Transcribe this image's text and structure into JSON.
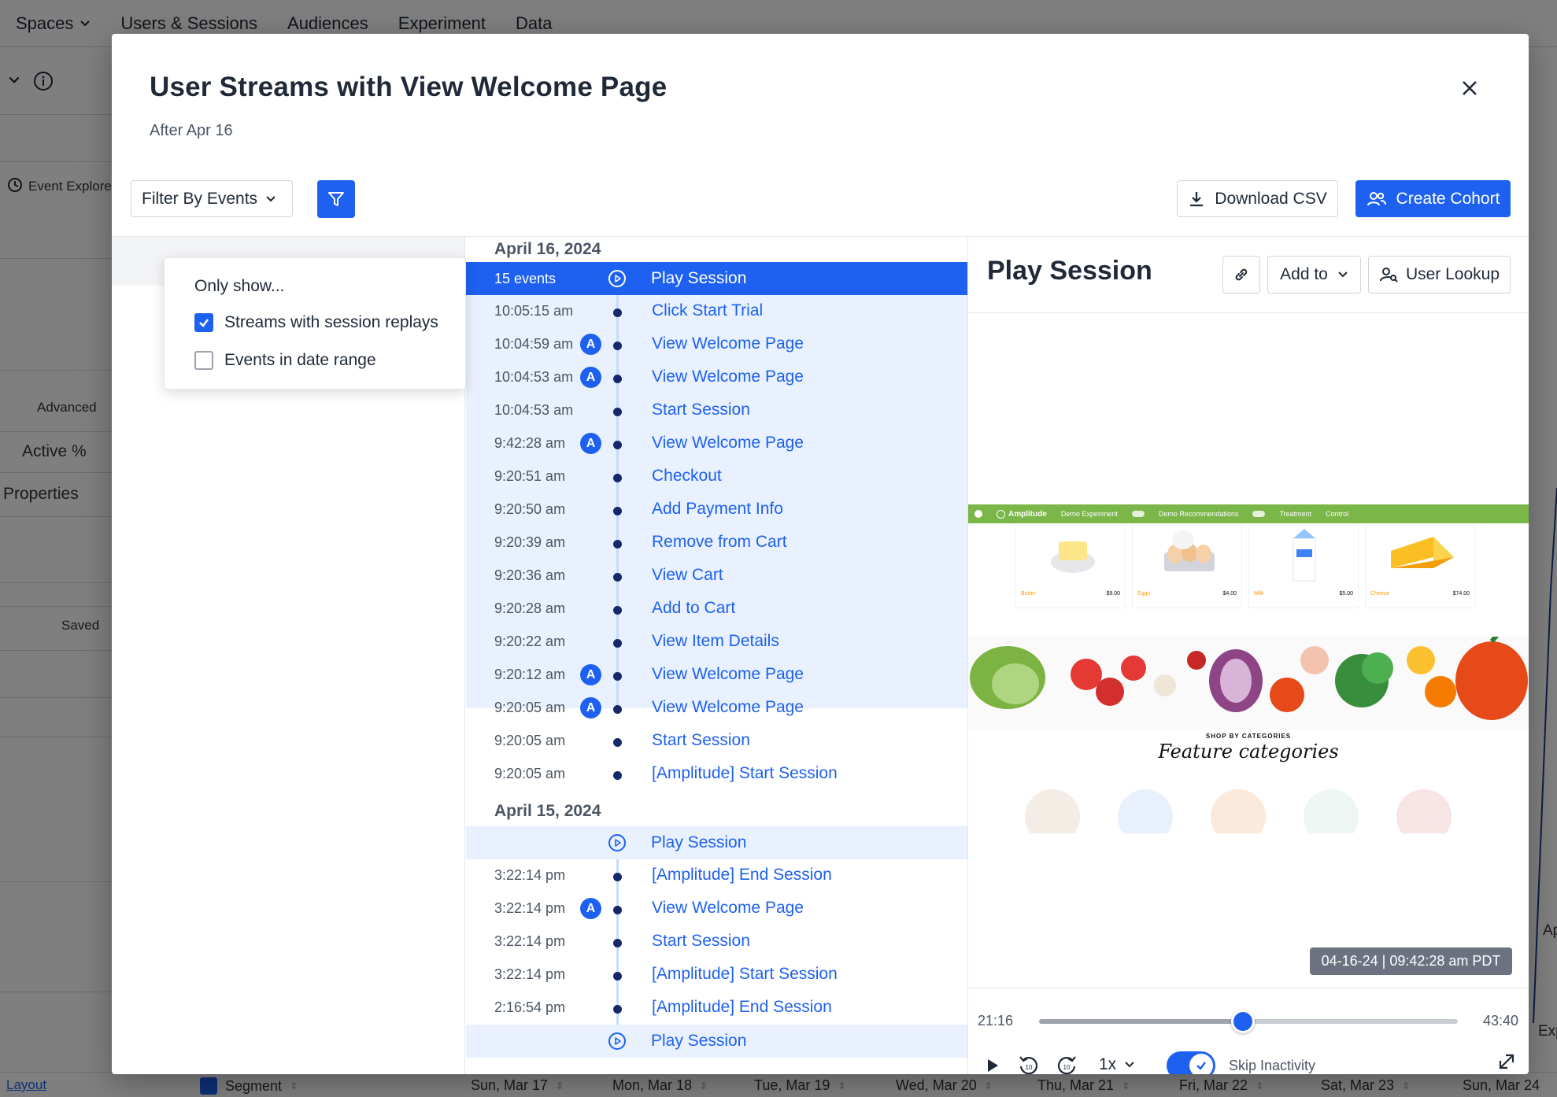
{
  "background": {
    "nav": [
      "Spaces",
      "Users & Sessions",
      "Audiences",
      "Experiment",
      "Data"
    ],
    "left_labels": [
      "Event Explore",
      "Advanced",
      "Active %",
      "Properties",
      "Saved"
    ],
    "bottom": {
      "segment": "Segment",
      "layout": "Layout",
      "columns": [
        "Sun, Mar 17",
        "Mon, Mar 18",
        "Tue, Mar 19",
        "Wed, Mar 20",
        "Thu, Mar 21",
        "Fri, Mar 22",
        "Sat, Mar 23",
        "Sun, Mar 24"
      ]
    },
    "right_edge": [
      "Ap",
      "Expo"
    ]
  },
  "modal": {
    "title": "User Streams with View Welcome Page",
    "subtitle": "After Apr 16",
    "filter_label": "Filter By Events",
    "download_label": "Download CSV",
    "create_cohort_label": "Create Cohort",
    "popover": {
      "title": "Only show...",
      "options": [
        {
          "label": "Streams with session replays",
          "checked": true
        },
        {
          "label": "Events in date range",
          "checked": false
        }
      ]
    }
  },
  "stream": {
    "day1": {
      "date": "April 16, 2024",
      "session": {
        "count": "15 events",
        "label": "Play Session"
      },
      "events": [
        {
          "time": "10:05:15 am",
          "name": "Click Start Trial",
          "badge": ""
        },
        {
          "time": "10:04:59 am",
          "name": "View Welcome Page",
          "badge": "A"
        },
        {
          "time": "10:04:53 am",
          "name": "View Welcome Page",
          "badge": "A"
        },
        {
          "time": "10:04:53 am",
          "name": "Start Session",
          "badge": ""
        },
        {
          "time": "9:42:28 am",
          "name": "View Welcome Page",
          "badge": "A"
        },
        {
          "time": "9:20:51 am",
          "name": "Checkout",
          "badge": ""
        },
        {
          "time": "9:20:50 am",
          "name": "Add Payment Info",
          "badge": ""
        },
        {
          "time": "9:20:39 am",
          "name": "Remove from Cart",
          "badge": ""
        },
        {
          "time": "9:20:36 am",
          "name": "View Cart",
          "badge": ""
        },
        {
          "time": "9:20:28 am",
          "name": "Add to Cart",
          "badge": ""
        },
        {
          "time": "9:20:22 am",
          "name": "View Item Details",
          "badge": ""
        },
        {
          "time": "9:20:12 am",
          "name": "View Welcome Page",
          "badge": "A"
        },
        {
          "time": "9:20:05 am",
          "name": "View Welcome Page",
          "badge": "A"
        },
        {
          "time": "9:20:05 am",
          "name": "Start Session",
          "badge": ""
        },
        {
          "time": "9:20:05 am",
          "name": "[Amplitude] Start Session",
          "badge": ""
        }
      ]
    },
    "day2": {
      "date": "April 15, 2024",
      "session": {
        "label": "Play Session"
      },
      "events": [
        {
          "time": "3:22:14 pm",
          "name": "[Amplitude] End Session",
          "badge": ""
        },
        {
          "time": "3:22:14 pm",
          "name": "View Welcome Page",
          "badge": "A"
        },
        {
          "time": "3:22:14 pm",
          "name": "Start Session",
          "badge": ""
        },
        {
          "time": "3:22:14 pm",
          "name": "[Amplitude] Start Session",
          "badge": ""
        },
        {
          "time": "2:16:54 pm",
          "name": "[Amplitude] End Session",
          "badge": ""
        }
      ],
      "session2": {
        "label": "Play Session"
      }
    }
  },
  "player": {
    "title": "Play Session",
    "add_to_label": "Add to",
    "user_lookup_label": "User Lookup",
    "timestamp": "04-16-24 | 09:42:28 am PDT",
    "time_current": "21:16",
    "time_total": "43:40",
    "progress": 0.487,
    "speed": "1x",
    "skip_inactivity_label": "Skip Inactivity",
    "skip_inactivity_on": true,
    "replay": {
      "brand": "Amplitude",
      "toggle1": "Demo Experiment",
      "toggle2": "Demo Recommendations",
      "legend1": "Treatment",
      "legend2": "Control",
      "products": [
        {
          "name": "Butter",
          "price": "$9.00"
        },
        {
          "name": "Eggs",
          "price": "$4.00"
        },
        {
          "name": "Milk",
          "price": "$5.00"
        },
        {
          "name": "Cheese",
          "price": "$74.00"
        }
      ],
      "categories_kicker": "SHOP BY CATEGORIES",
      "categories_title": "Feature categories"
    }
  },
  "colors": {
    "accent": "#1e61f0",
    "session_bg": "#e8f1fd",
    "dot": "#14286b",
    "replay_green": "#7ab648"
  }
}
